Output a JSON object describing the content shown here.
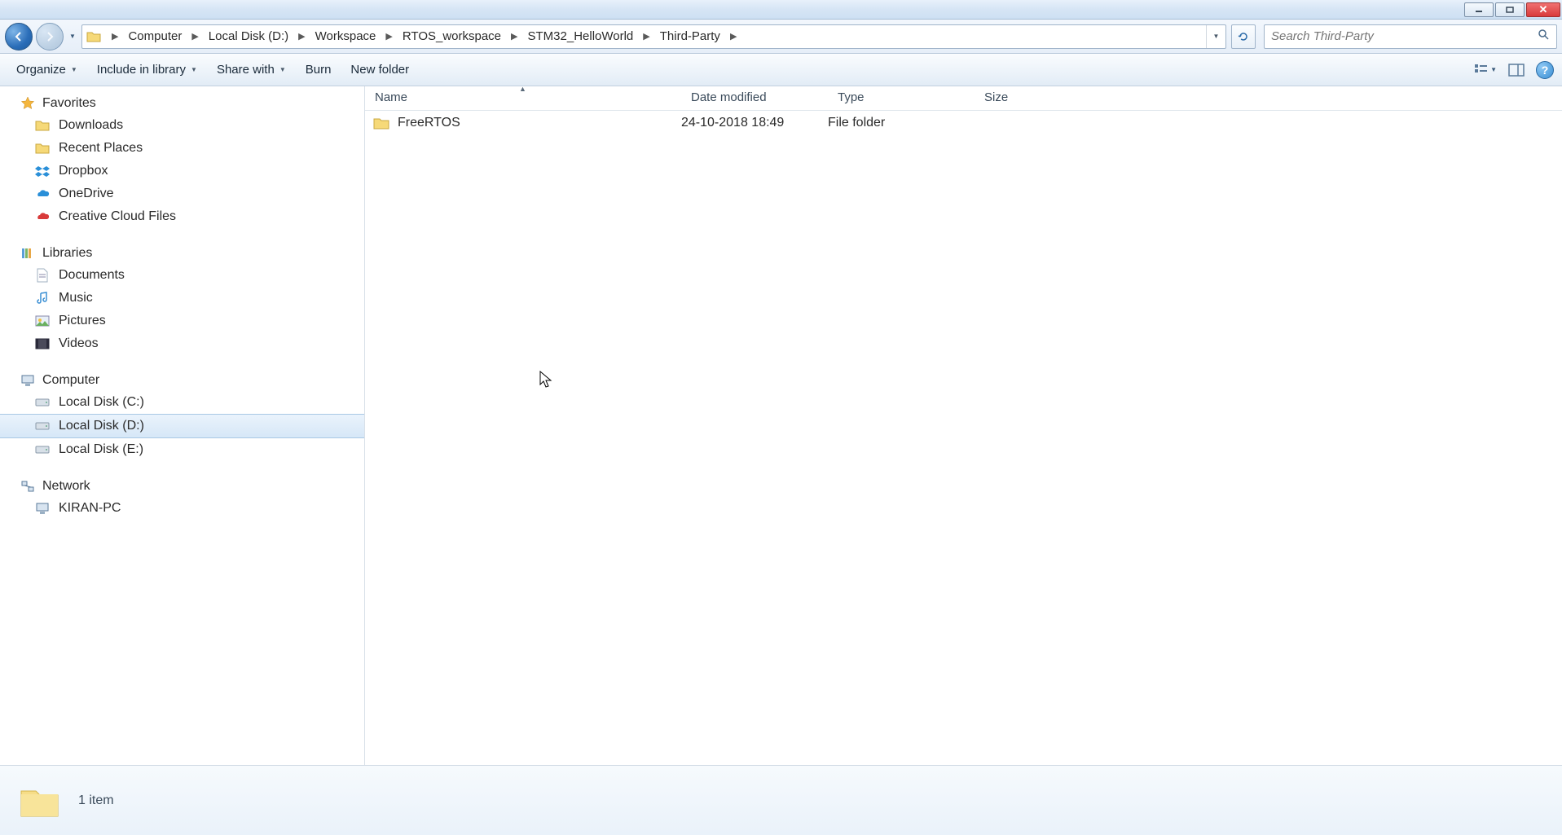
{
  "window": {
    "minimize": "_",
    "maximize": "☐",
    "close": "✕"
  },
  "breadcrumbs": [
    "Computer",
    "Local Disk (D:)",
    "Workspace",
    "RTOS_workspace",
    "STM32_HelloWorld",
    "Third-Party"
  ],
  "search": {
    "placeholder": "Search Third-Party"
  },
  "toolbar": {
    "organize": "Organize",
    "include": "Include in library",
    "share": "Share with",
    "burn": "Burn",
    "newfolder": "New folder"
  },
  "sidebar": {
    "favorites": {
      "label": "Favorites",
      "items": [
        "Downloads",
        "Recent Places",
        "Dropbox",
        "OneDrive",
        "Creative Cloud Files"
      ]
    },
    "libraries": {
      "label": "Libraries",
      "items": [
        "Documents",
        "Music",
        "Pictures",
        "Videos"
      ]
    },
    "computer": {
      "label": "Computer",
      "items": [
        "Local Disk (C:)",
        "Local Disk (D:)",
        "Local Disk (E:)"
      ],
      "selected_index": 1
    },
    "network": {
      "label": "Network",
      "items": [
        "KIRAN-PC"
      ]
    }
  },
  "columns": {
    "name": "Name",
    "date": "Date modified",
    "type": "Type",
    "size": "Size"
  },
  "files": [
    {
      "name": "FreeRTOS",
      "date": "24-10-2018 18:49",
      "type": "File folder",
      "size": ""
    }
  ],
  "status": {
    "text": "1 item"
  },
  "help": "?"
}
